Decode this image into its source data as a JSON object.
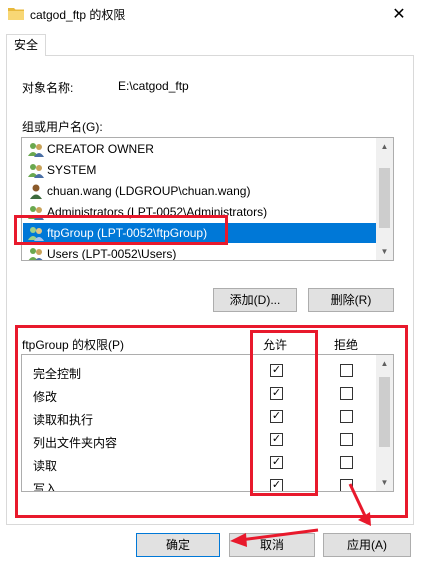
{
  "window": {
    "title": "catgod_ftp 的权限",
    "close_glyph": "✕"
  },
  "tabs": [
    {
      "label": "安全"
    }
  ],
  "object": {
    "label": "对象名称:",
    "value": "E:\\catgod_ftp"
  },
  "groups": {
    "label": "组或用户名(G):",
    "items": [
      {
        "name": "CREATOR OWNER",
        "icon": "group-icon"
      },
      {
        "name": "SYSTEM",
        "icon": "group-icon"
      },
      {
        "name": "chuan.wang (LDGROUP\\chuan.wang)",
        "icon": "user-icon"
      },
      {
        "name": "Administrators (LPT-0052\\Administrators)",
        "icon": "group-icon"
      },
      {
        "name": "ftpGroup (LPT-0052\\ftpGroup)",
        "icon": "group-icon",
        "selected": true
      },
      {
        "name": "Users (LPT-0052\\Users)",
        "icon": "group-icon"
      }
    ]
  },
  "buttons": {
    "add": "添加(D)...",
    "remove": "删除(R)",
    "ok": "确定",
    "cancel": "取消",
    "apply": "应用(A)"
  },
  "permissions": {
    "label": "ftpGroup 的权限(P)",
    "allow_header": "允许",
    "deny_header": "拒绝",
    "rows": [
      {
        "name": "完全控制",
        "allow": true,
        "deny": false
      },
      {
        "name": "修改",
        "allow": true,
        "deny": false
      },
      {
        "name": "读取和执行",
        "allow": true,
        "deny": false
      },
      {
        "name": "列出文件夹内容",
        "allow": true,
        "deny": false
      },
      {
        "name": "读取",
        "allow": true,
        "deny": false
      },
      {
        "name": "写入",
        "allow": true,
        "deny": false
      }
    ]
  },
  "colors": {
    "selection": "#0078d7",
    "annotation": "#e8192c"
  }
}
